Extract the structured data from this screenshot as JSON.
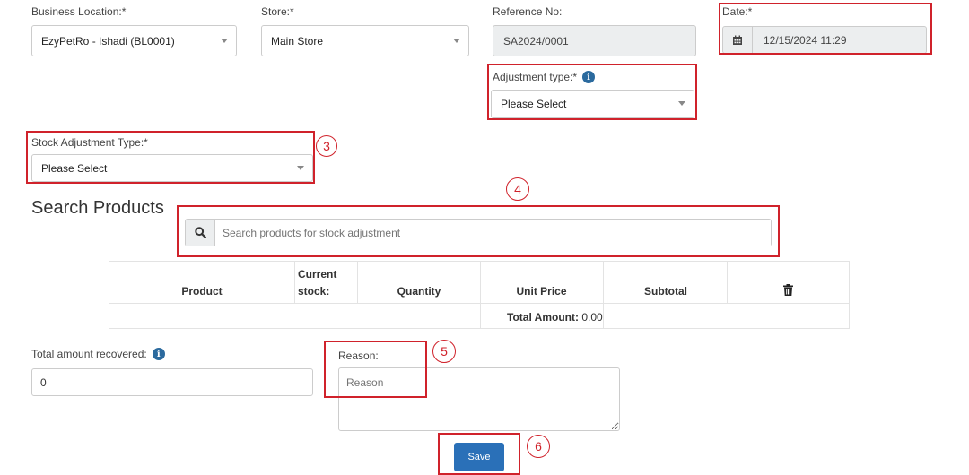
{
  "fields": {
    "business_location": {
      "label": "Business Location:*",
      "value": "EzyPetRo - Ishadi (BL0001)"
    },
    "store": {
      "label": "Store:*",
      "value": "Main Store"
    },
    "reference_no": {
      "label": "Reference No:",
      "value": "SA2024/0001"
    },
    "date": {
      "label": "Date:*",
      "value": "12/15/2024 11:29"
    },
    "adjustment_type": {
      "label": "Adjustment type:*",
      "value": "Please Select"
    },
    "stock_adjustment_type": {
      "label": "Stock Adjustment Type:*",
      "value": "Please Select"
    }
  },
  "search": {
    "heading": "Search Products",
    "placeholder": "Search products for stock adjustment"
  },
  "table": {
    "headers": {
      "product": "Product",
      "current_stock_line1": "Current",
      "current_stock_line2": "stock:",
      "quantity": "Quantity",
      "unit_price": "Unit Price",
      "subtotal": "Subtotal"
    },
    "total_label": "Total Amount:",
    "total_value": "0.00"
  },
  "recovered": {
    "label": "Total amount recovered:",
    "value": "0"
  },
  "reason": {
    "label": "Reason:",
    "placeholder": "Reason"
  },
  "save_label": "Save",
  "annotations": {
    "n3": "3",
    "n4": "4",
    "n5": "5",
    "n6": "6"
  },
  "colors": {
    "annotation": "#d0222b",
    "primary": "#2a70b8",
    "info": "#2b6a9e"
  }
}
